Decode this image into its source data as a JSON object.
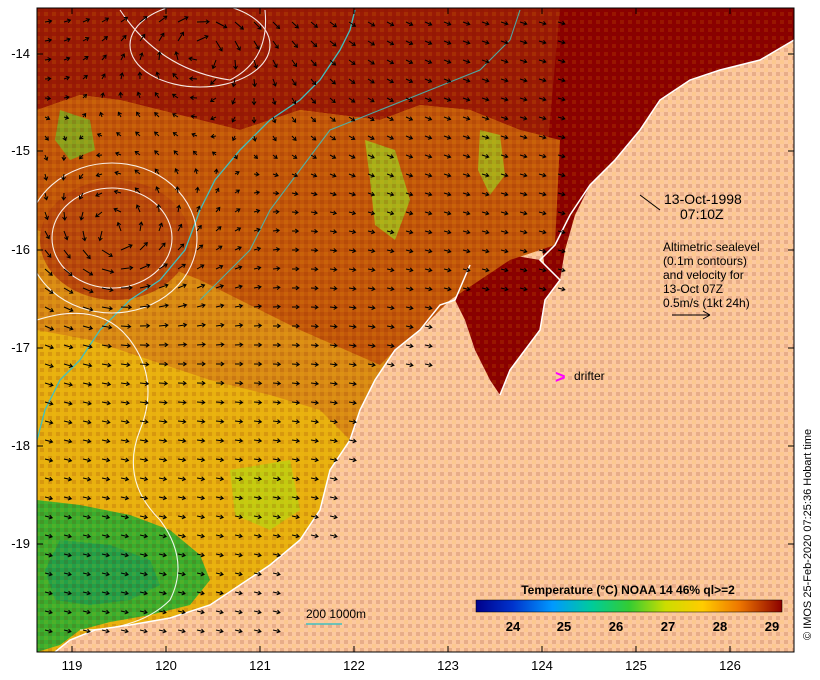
{
  "map": {
    "y_ticks": [
      "-14",
      "-15",
      "-16",
      "-17",
      "-18",
      "-19"
    ],
    "x_ticks": [
      "119",
      "120",
      "121",
      "122",
      "123",
      "124",
      "125",
      "126"
    ],
    "timestamp_lines": [
      "13-Oct-1998",
      "07:10Z"
    ],
    "altimetry_lines": [
      "Altimetric sealevel",
      "(0.1m contours)",
      "and velocity for",
      "13-Oct 07Z",
      "0.5m/s (1kt 24h)"
    ],
    "drifter_symbol": ">",
    "drifter_label": "drifter",
    "depth_legend": "200  1000m",
    "colorbar_title": "Temperature (°C) NOAA 14 46% ql>=2",
    "colorbar_ticks": [
      "24",
      "25",
      "26",
      "27",
      "28",
      "29"
    ],
    "credit": "© IMOS 25-Feb-2020 07:25:36 Hobart time",
    "colors": {
      "land": "#fcc8a0",
      "sst_hot": "#8b0000",
      "sst_warm": "#cc5500",
      "sst_mid": "#e09a10",
      "sst_cool": "#2fa82f",
      "contour": "#ffffff",
      "isobath": "#40c0c0",
      "drifter": "#ff00ff"
    }
  }
}
